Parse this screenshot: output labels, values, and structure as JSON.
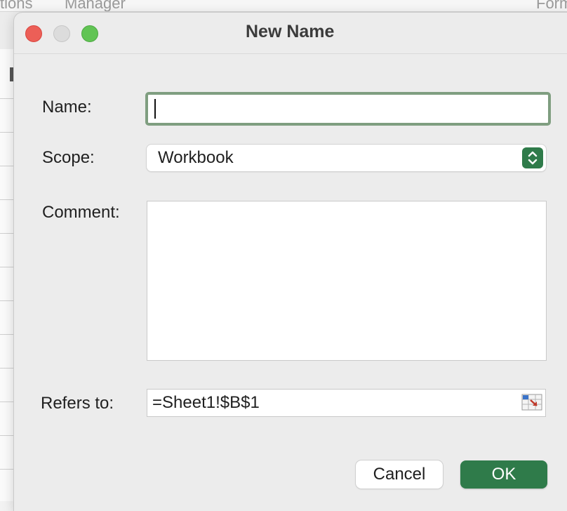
{
  "background_ribbon": {
    "fragment_left": "tions",
    "fragment_manager": "Manager",
    "fragment_right": "Form"
  },
  "dialog": {
    "title": "New Name",
    "window_controls": {
      "close_color": "#ec5f57",
      "minimize_color": "#dcdcdc",
      "maximize_color": "#61c454"
    },
    "name": {
      "label": "Name:",
      "value": ""
    },
    "scope": {
      "label": "Scope:",
      "selected": "Workbook",
      "stepper_icon": "up-down-chevron-icon"
    },
    "comment": {
      "label": "Comment:",
      "value": ""
    },
    "refers_to": {
      "label": "Refers to:",
      "value": "=Sheet1!$B$1",
      "collapse_icon": "range-collapse-icon"
    },
    "buttons": {
      "cancel": "Cancel",
      "ok": "OK"
    },
    "accent_color": "#2f7b4a"
  }
}
